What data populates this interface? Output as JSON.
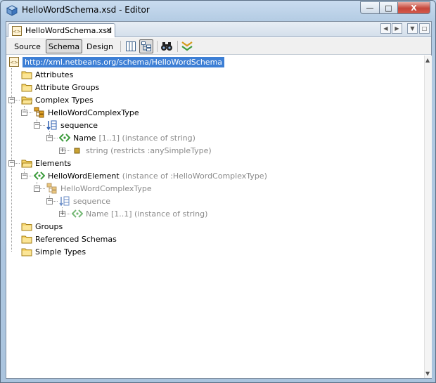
{
  "window": {
    "title": "HelloWordSchema.xsd - Editor",
    "buttons": {
      "minimize": "—",
      "maximize": "□",
      "close": "X"
    }
  },
  "tab": {
    "label": "HelloWordSchema.xsd",
    "close": "x"
  },
  "toolbar": {
    "source": "Source",
    "schema": "Schema",
    "design": "Design"
  },
  "tree": {
    "root": "http://xml.netbeans.org/schema/HelloWordSchema",
    "attributes": "Attributes",
    "attribute_groups": "Attribute Groups",
    "complex_types": "Complex Types",
    "hello_word_complex_type": "HelloWordComplexType",
    "sequence": "sequence",
    "name": "Name",
    "name_detail": "[1..1] (instance of string)",
    "string": "string (restricts :anySimpleType)",
    "elements": "Elements",
    "hello_word_element": "HelloWordElement",
    "hello_word_element_detail": "(instance of :HelloWordComplexType)",
    "hwe_complex_type": "HelloWordComplexType",
    "hwe_sequence": "sequence",
    "hwe_name": "Name [1..1] (instance of string)",
    "groups": "Groups",
    "referenced_schemas": "Referenced Schemas",
    "simple_types": "Simple Types"
  }
}
